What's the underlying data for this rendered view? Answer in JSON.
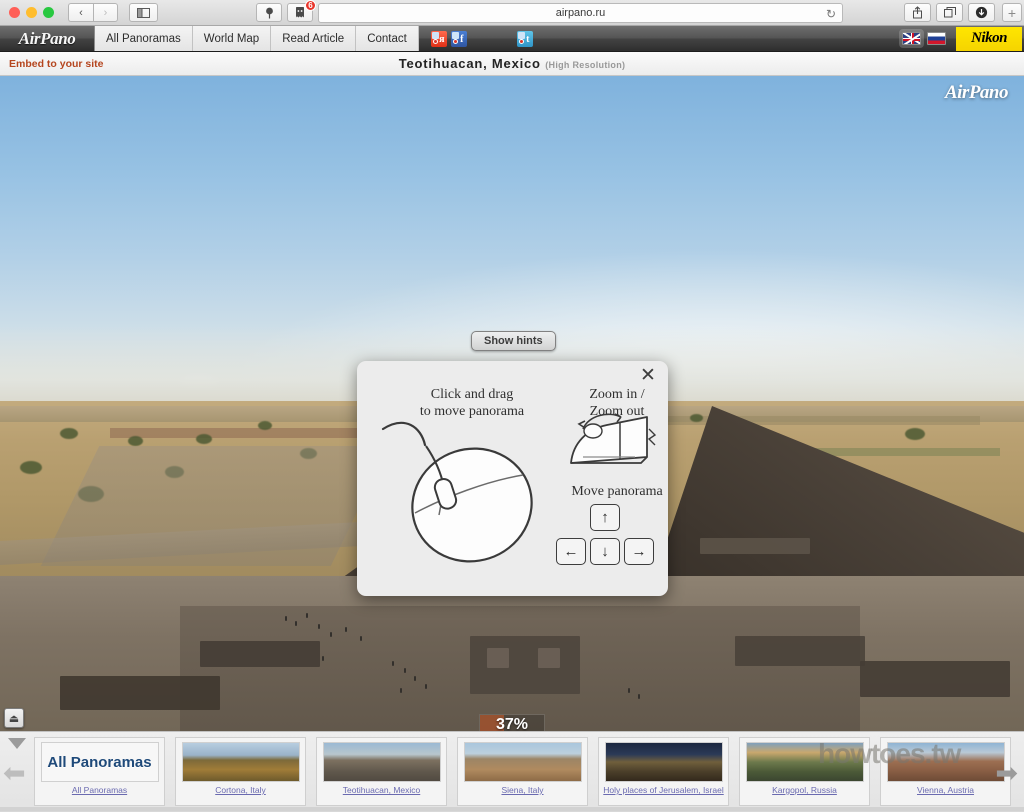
{
  "browser": {
    "back_label": "‹",
    "forward_label": "›",
    "sidebar_icon": "sidebar-icon",
    "pin_icon": "pin-icon",
    "adblock_icon": "adblock-shield-icon",
    "adblock_badge": "6",
    "url": "airpano.ru",
    "reload_label": "↻",
    "share_label": "⇧",
    "tabs_label": "⧉",
    "downloads_label": "⬇",
    "new_tab_label": "+"
  },
  "site_header": {
    "logo": "AirPano",
    "nav": [
      {
        "label": "All Panoramas"
      },
      {
        "label": "World Map"
      },
      {
        "label": "Read Article"
      },
      {
        "label": "Contact"
      }
    ],
    "social": [
      {
        "name": "vkontakte-icon",
        "glyph": "я"
      },
      {
        "name": "facebook-icon",
        "glyph": "f"
      },
      {
        "name": "twitter-icon",
        "glyph": "t"
      }
    ],
    "lang_en": "en-flag-icon",
    "lang_ru": "ru-flag-icon",
    "sponsor": "Nikon"
  },
  "sub_header": {
    "embed_label": "Embed to your site",
    "title": "Teotihuacan, Mexico",
    "resolution": "(High Resolution)"
  },
  "panorama": {
    "watermark": "AirPano",
    "show_hints_label": "Show hints",
    "progress_percent": "37%",
    "progress_value": 37
  },
  "hints_modal": {
    "close_label": "✕",
    "drag_title_line1": "Click and drag",
    "drag_title_line2": "to move panorama",
    "zoom_title": "Zoom in / Zoom out",
    "move_title": "Move panorama",
    "keys": {
      "up": "↑",
      "left": "←",
      "down": "↓",
      "right": "→"
    }
  },
  "filmstrip": {
    "eject_label": "⏏",
    "collapse_label": "collapse-triangle-icon",
    "prev_label": "⬅",
    "next_label": "➡",
    "watermark": "howtoes.tw",
    "thumbs": [
      {
        "label": "All Panoramas",
        "art": "t-all",
        "overlay": "All Panoramas"
      },
      {
        "label": "Cortona, Italy",
        "art": "t-cortona",
        "overlay": ""
      },
      {
        "label": "Teotihuacan, Mexico",
        "art": "t-teo",
        "overlay": ""
      },
      {
        "label": "Siena, Italy",
        "art": "t-siena",
        "overlay": ""
      },
      {
        "label": "Holy places of Jerusalem, Israel",
        "art": "t-jerus",
        "overlay": ""
      },
      {
        "label": "Kargopol, Russia",
        "art": "t-kargo",
        "overlay": ""
      },
      {
        "label": "Vienna, Austria",
        "art": "t-vienna",
        "overlay": ""
      }
    ]
  },
  "colors": {
    "accent_orange": "#b5461f",
    "nikon_yellow": "#ffe600",
    "link_purple": "#6a6ab0",
    "badge_red": "#e8352b",
    "progress_orange": "#af552d"
  }
}
